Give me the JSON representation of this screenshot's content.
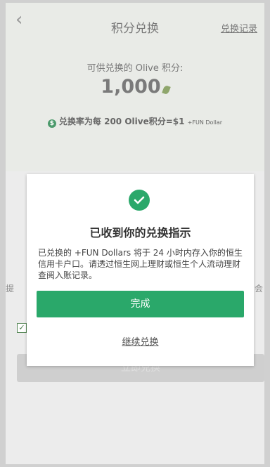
{
  "header": {
    "title": "积分兑换",
    "record_link": "兑换记录"
  },
  "summary": {
    "available_label": "可供兑换的 Olive 积分:",
    "points": "1,000",
    "rate_coin": "$",
    "rate_text": "兑换率为每 200 Olive积分=$1",
    "rate_unit": "+FUN Dollar"
  },
  "background": {
    "left_fragment": "提",
    "right_fragment": "会",
    "button_label": "立即兑换"
  },
  "modal": {
    "title": "已收到你的兑换指示",
    "message": "已兑换的 +FUN Dollars 将于 24 小时内存入你的恒生信用卡户口。请透过恒生网上理财或恒生个人流动理财查阅入账记录。",
    "done_label": "完成",
    "continue_label": "继续兑换"
  },
  "colors": {
    "accent": "#2aa86a",
    "overlay": "#ebebeb"
  }
}
